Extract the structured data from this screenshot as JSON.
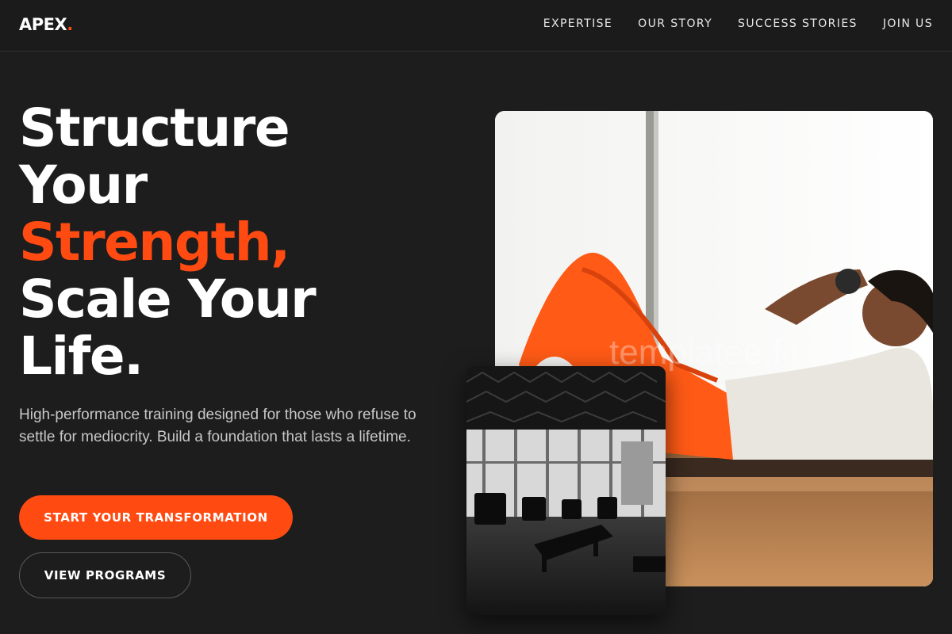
{
  "brand": {
    "name": "APEX",
    "dot": ".",
    "accent_color": "#ff4a12"
  },
  "nav": {
    "items": [
      {
        "label": "EXPERTISE"
      },
      {
        "label": "OUR STORY"
      },
      {
        "label": "SUCCESS STORIES"
      },
      {
        "label": "JOIN US"
      }
    ]
  },
  "hero": {
    "headline_lines": [
      "Structure",
      "Your",
      "Strength,",
      "Scale Your",
      "Life."
    ],
    "subtitle": "High-performance training designed for those who refuse to settle for mediocrity. Build a foundation that lasts a lifetime.",
    "primary_cta": "START YOUR TRANSFORMATION",
    "secondary_cta": "VIEW PROGRAMS"
  },
  "images": {
    "main_photo_icon": "woman-doing-crunches-photo",
    "secondary_photo_icon": "gym-interior-photo",
    "watermark": "templatee.fit"
  }
}
